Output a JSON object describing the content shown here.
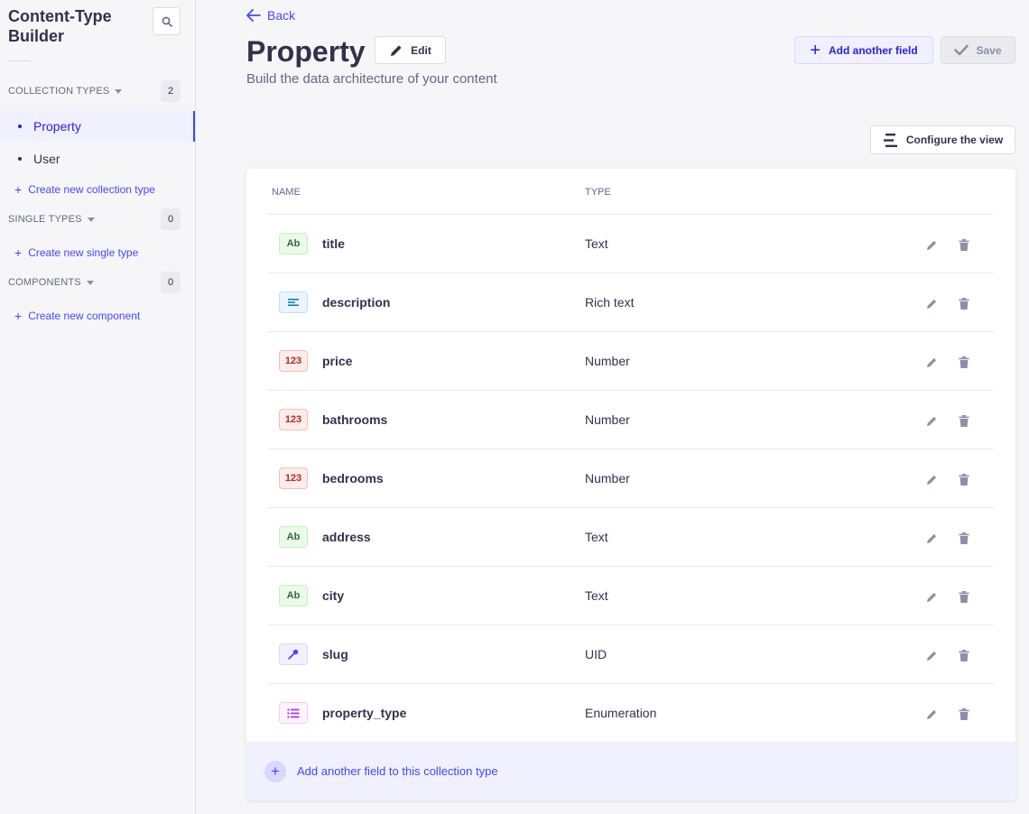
{
  "sidebar": {
    "title": "Content-Type Builder",
    "collection_types": {
      "label": "COLLECTION TYPES",
      "count": "2",
      "items": [
        {
          "label": "Property"
        },
        {
          "label": "User"
        }
      ],
      "create_label": "Create new collection type"
    },
    "single_types": {
      "label": "SINGLE TYPES",
      "count": "0",
      "create_label": "Create new single type"
    },
    "components": {
      "label": "COMPONENTS",
      "count": "0",
      "create_label": "Create new component"
    }
  },
  "header": {
    "back_label": "Back",
    "title": "Property",
    "edit_label": "Edit",
    "subtitle": "Build the data architecture of your content",
    "add_field_label": "Add another field",
    "save_label": "Save",
    "configure_label": "Configure the view"
  },
  "table": {
    "columns": [
      "NAME",
      "TYPE"
    ],
    "rows": [
      {
        "icon": "Ab",
        "kind": "text",
        "name": "title",
        "type": "Text"
      },
      {
        "icon": "rich-text-icon",
        "kind": "richtext",
        "name": "description",
        "type": "Rich text"
      },
      {
        "icon": "123",
        "kind": "number",
        "name": "price",
        "type": "Number"
      },
      {
        "icon": "123",
        "kind": "number",
        "name": "bathrooms",
        "type": "Number"
      },
      {
        "icon": "123",
        "kind": "number",
        "name": "bedrooms",
        "type": "Number"
      },
      {
        "icon": "Ab",
        "kind": "text",
        "name": "address",
        "type": "Text"
      },
      {
        "icon": "Ab",
        "kind": "text",
        "name": "city",
        "type": "Text"
      },
      {
        "icon": "key-icon",
        "kind": "uid",
        "name": "slug",
        "type": "UID"
      },
      {
        "icon": "list-icon",
        "kind": "enum",
        "name": "property_type",
        "type": "Enumeration"
      }
    ],
    "footer_label": "Add another field to this collection type"
  },
  "colors": {
    "primary": "#4945ff",
    "primary_light": "#f0f0ff",
    "text": "#32324d",
    "muted": "#666687"
  }
}
